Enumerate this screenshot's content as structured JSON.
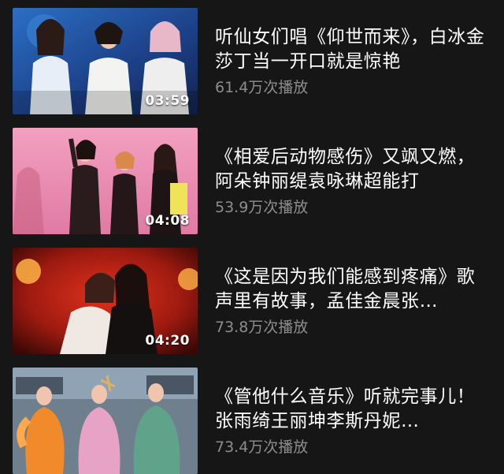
{
  "videos": [
    {
      "title": "听仙女们唱《仰世而来》，白冰金莎丁当一开口就是惊艳",
      "views": "61.4万次播放",
      "duration": "03:59"
    },
    {
      "title": "《相爱后动物感伤》又飒又燃，阿朵钟丽缇袁咏琳超能打",
      "views": "53.9万次播放",
      "duration": "04:08"
    },
    {
      "title": "《这是因为我们能感到疼痛》歌声里有故事，孟佳金晨张…",
      "views": "73.8万次播放",
      "duration": "04:20"
    },
    {
      "title": "《管他什么音乐》听就完事儿！张雨绮王丽坤李斯丹妮…",
      "views": "73.4万次播放",
      "duration": ""
    }
  ],
  "colors": {
    "background": "#161616",
    "title": "#ffffff",
    "views": "#8d8d8d"
  }
}
